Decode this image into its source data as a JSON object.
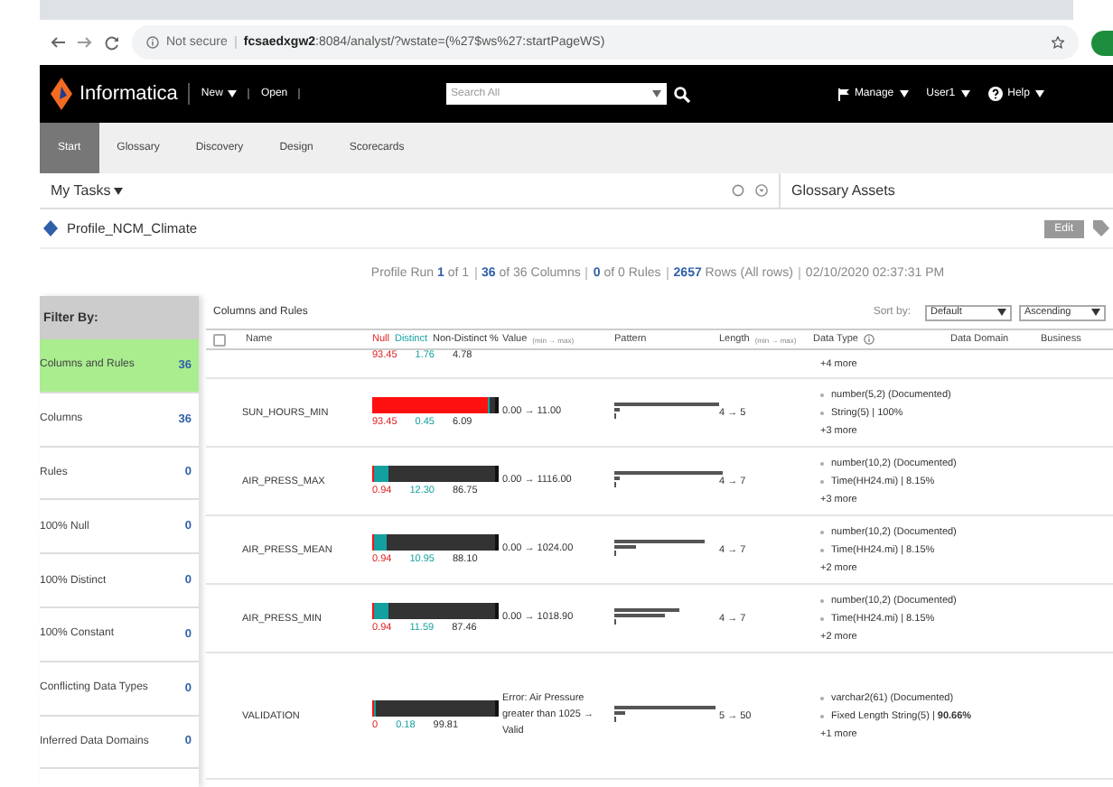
{
  "browser": {
    "security": "Not secure",
    "url": "**fcsaedxgw2**:8084/analyst/?wstate=(%27$ws%27:startPageWS)"
  },
  "header": {
    "brand": "Informatica",
    "menus": [
      {
        "label": "New",
        "dropdown": true
      },
      {
        "label": "Open",
        "dropdown": false
      }
    ],
    "search": {
      "placeholder": "Search All"
    },
    "right_menus": [
      {
        "label": "Manage"
      },
      {
        "label": "User1"
      },
      {
        "label": "Help"
      }
    ]
  },
  "tabs": [
    {
      "label": "Start",
      "selected": true
    },
    {
      "label": "Glossary",
      "selected": false
    },
    {
      "label": "Discovery",
      "selected": false
    },
    {
      "label": "Design",
      "selected": false
    },
    {
      "label": "Scorecards",
      "selected": false
    }
  ],
  "my_tasks": "My Tasks",
  "glossary_assets": "Glossary Assets",
  "profile": {
    "title": "Profile_NCM_Climate",
    "edit": "Edit"
  },
  "summary": [
    "Profile Run **1** of 1",
    "**36** of 36 Columns",
    "**0** of 0 Rules",
    "**2657** Rows (All rows)",
    "02/10/2020 02:37:31 PM"
  ],
  "filter": {
    "title": "Filter By:",
    "items": [
      {
        "label": "Columns and Rules",
        "count": "36",
        "selected": true
      },
      {
        "label": "Columns",
        "count": "36",
        "selected": false
      },
      {
        "label": "Rules",
        "count": "0",
        "selected": false
      },
      {
        "label": "100% Null",
        "count": "0",
        "selected": false
      },
      {
        "label": "100% Distinct",
        "count": "0",
        "selected": false
      },
      {
        "label": "100% Constant",
        "count": "0",
        "selected": false
      },
      {
        "label": "Conflicting Data Types",
        "count": "0",
        "selected": false
      },
      {
        "label": "Inferred Data Domains",
        "count": "0",
        "selected": false
      }
    ]
  },
  "table": {
    "title": "Columns and Rules",
    "sort_label": "Sort by:",
    "sort_field": "Default",
    "sort_order": "Ascending",
    "select_all": {
      "checked": false
    },
    "columns": {
      "name": "Name",
      "null": "Null",
      "distinct": "Distinct",
      "non_distinct": "Non-Distinct %",
      "value": "Value",
      "value_hint": "(min → max)",
      "pattern": "Pattern",
      "length": "Length",
      "length_hint": "(min → max)",
      "data_type": "Data Type",
      "data_domain": "Data Domain",
      "business": "Business"
    },
    "partial_row": {
      "null": "93.45",
      "distinct": "1.76",
      "non_distinct": "4.78",
      "more": "+4 more"
    },
    "rows": [
      {
        "name": "SUN_HOURS_MIN",
        "null_bar": {
          "level": 0.9345
        },
        "distinct_bar": {
          "level": 0.0045
        },
        "null": "93.45",
        "distinct": "0.45",
        "non_distinct": "6.09",
        "value": "0.00 → 11.00",
        "length": "4 → 5",
        "data_types": [
          "number(5,2) (Documented)",
          "String(5) | 100%"
        ],
        "more": "+3 more"
      },
      {
        "name": "AIR_PRESS_MAX",
        "null_bar": {
          "level": 0.0094
        },
        "distinct_bar": {
          "level": 0.123
        },
        "null": "0.94",
        "distinct": "12.30",
        "non_distinct": "86.75",
        "value": "0.00 → 1116.00",
        "length": "4 → 7",
        "data_types": [
          "number(10,2) (Documented)",
          "Time(HH24.mi) | 8.15%"
        ],
        "more": "+3 more"
      },
      {
        "name": "AIR_PRESS_MEAN",
        "null_bar": {
          "level": 0.0094
        },
        "distinct_bar": {
          "level": 0.1095
        },
        "null": "0.94",
        "distinct": "10.95",
        "non_distinct": "88.10",
        "value": "0.00 → 1024.00",
        "length": "4 → 7",
        "data_types": [
          "number(10,2) (Documented)",
          "Time(HH24.mi) | 8.15%"
        ],
        "more": "+2 more"
      },
      {
        "name": "AIR_PRESS_MIN",
        "null_bar": {
          "level": 0.0094
        },
        "distinct_bar": {
          "level": 0.1159
        },
        "null": "0.94",
        "distinct": "11.59",
        "non_distinct": "87.46",
        "value": "0.00 → 1018.90",
        "length": "4 → 7",
        "data_types": [
          "number(10,2) (Documented)",
          "Time(HH24.mi) | 8.15%"
        ],
        "more": "+2 more"
      },
      {
        "name": "VALIDATION",
        "null_bar": {
          "level": 0
        },
        "distinct_bar": {
          "level": 0.0018
        },
        "null": "0",
        "distinct": "0.18",
        "non_distinct": "99.81",
        "value": "Error: Air Pressure greater than 1025 → Valid",
        "length": "5 → 50",
        "data_types": [
          "varchar2(61) (Documented)",
          "Fixed Length String(5) | **90.66%**"
        ],
        "more": "+1 more"
      }
    ]
  }
}
